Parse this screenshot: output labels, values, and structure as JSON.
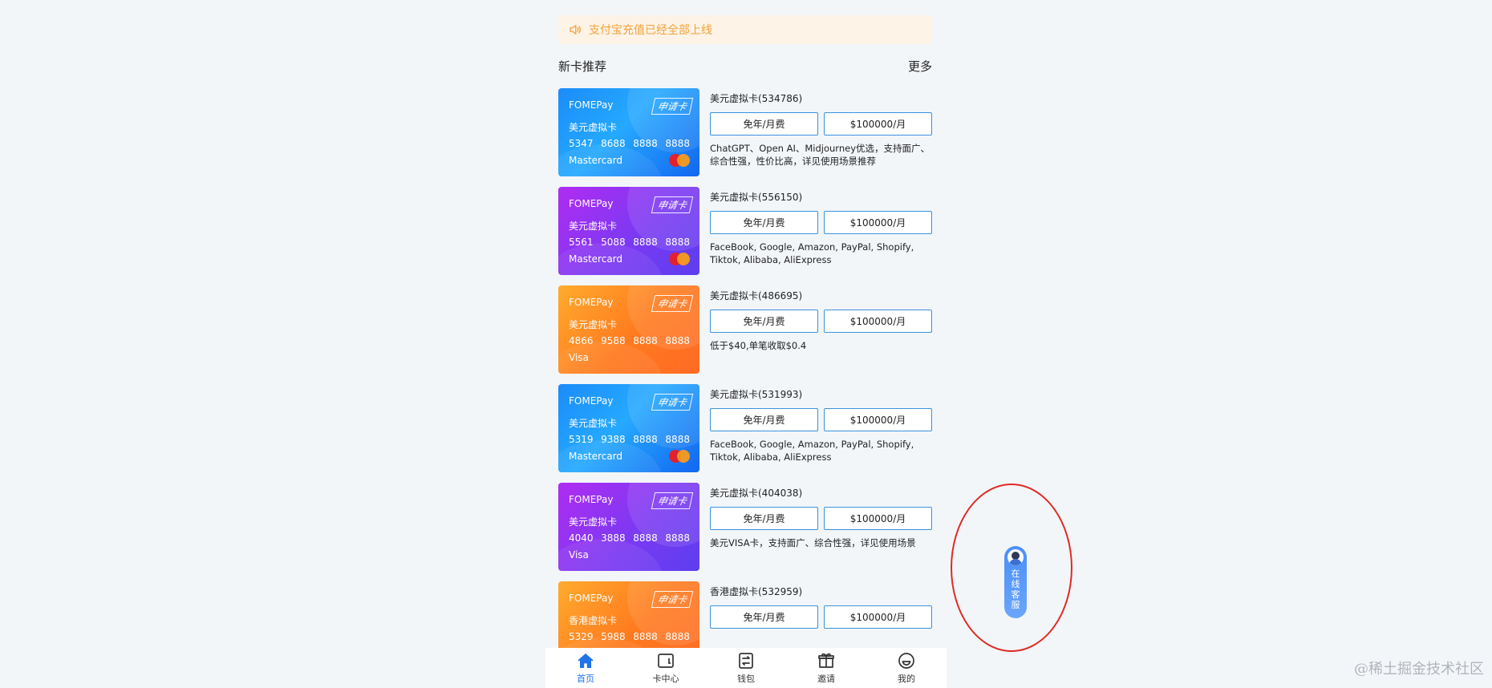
{
  "notice": {
    "text": "支付宝充值已经全部上线"
  },
  "section": {
    "title": "新卡推荐",
    "more": "更多"
  },
  "cards": [
    {
      "theme": "blue",
      "brand": "FOMEPay",
      "apply": "申请卡",
      "card_type": "美元虚拟卡",
      "numbers": [
        "5347",
        "8688",
        "8888",
        "8888"
      ],
      "network": "Mastercard",
      "name": "美元虚拟卡(534786)",
      "fee": "免年/月费",
      "limit": "$100000/月",
      "desc": "ChatGPT、Open AI、Midjourney优选，支持面广、综合性强，性价比高，详见使用场景推荐"
    },
    {
      "theme": "purple",
      "brand": "FOMEPay",
      "apply": "申请卡",
      "card_type": "美元虚拟卡",
      "numbers": [
        "5561",
        "5088",
        "8888",
        "8888"
      ],
      "network": "Mastercard",
      "name": "美元虚拟卡(556150)",
      "fee": "免年/月费",
      "limit": "$100000/月",
      "desc": "FaceBook, Google, Amazon, PayPal, Shopify, Tiktok, Alibaba, AliExpress"
    },
    {
      "theme": "orange",
      "brand": "FOMEPay",
      "apply": "申请卡",
      "card_type": "美元虚拟卡",
      "numbers": [
        "4866",
        "9588",
        "8888",
        "8888"
      ],
      "network": "Visa",
      "name": "美元虚拟卡(486695)",
      "fee": "免年/月费",
      "limit": "$100000/月",
      "desc": "低于$40,单笔收取$0.4"
    },
    {
      "theme": "blue",
      "brand": "FOMEPay",
      "apply": "申请卡",
      "card_type": "美元虚拟卡",
      "numbers": [
        "5319",
        "9388",
        "8888",
        "8888"
      ],
      "network": "Mastercard",
      "name": "美元虚拟卡(531993)",
      "fee": "免年/月费",
      "limit": "$100000/月",
      "desc": "FaceBook, Google, Amazon, PayPal, Shopify, Tiktok, Alibaba, AliExpress"
    },
    {
      "theme": "purple",
      "brand": "FOMEPay",
      "apply": "申请卡",
      "card_type": "美元虚拟卡",
      "numbers": [
        "4040",
        "3888",
        "8888",
        "8888"
      ],
      "network": "Visa",
      "name": "美元虚拟卡(404038)",
      "fee": "免年/月费",
      "limit": "$100000/月",
      "desc": "美元VISA卡，支持面广、综合性强，详见使用场景"
    },
    {
      "theme": "orange",
      "brand": "FOMEPay",
      "apply": "申请卡",
      "card_type": "香港虚拟卡",
      "numbers": [
        "5329",
        "5988",
        "8888",
        "8888"
      ],
      "network": "",
      "name": "香港虚拟卡(532959)",
      "fee": "免年/月费",
      "limit": "$100000/月",
      "desc": ""
    }
  ],
  "tabbar": {
    "items": [
      {
        "label": "首页",
        "icon": "home-icon",
        "active": true
      },
      {
        "label": "卡中心",
        "icon": "wallet-card-icon",
        "active": false
      },
      {
        "label": "钱包",
        "icon": "exchange-icon",
        "active": false
      },
      {
        "label": "邀请",
        "icon": "gift-icon",
        "active": false
      },
      {
        "label": "我的",
        "icon": "smile-icon",
        "active": false
      }
    ]
  },
  "customer_service": {
    "label": "在线客服"
  },
  "watermark": "@稀土掘金技术社区",
  "colors": {
    "accent": "#1e73e8",
    "notice_text": "#f3a23a",
    "notice_bg": "#fdf3e6",
    "button_border": "#3a93e0",
    "highlight": "#e02a24"
  }
}
